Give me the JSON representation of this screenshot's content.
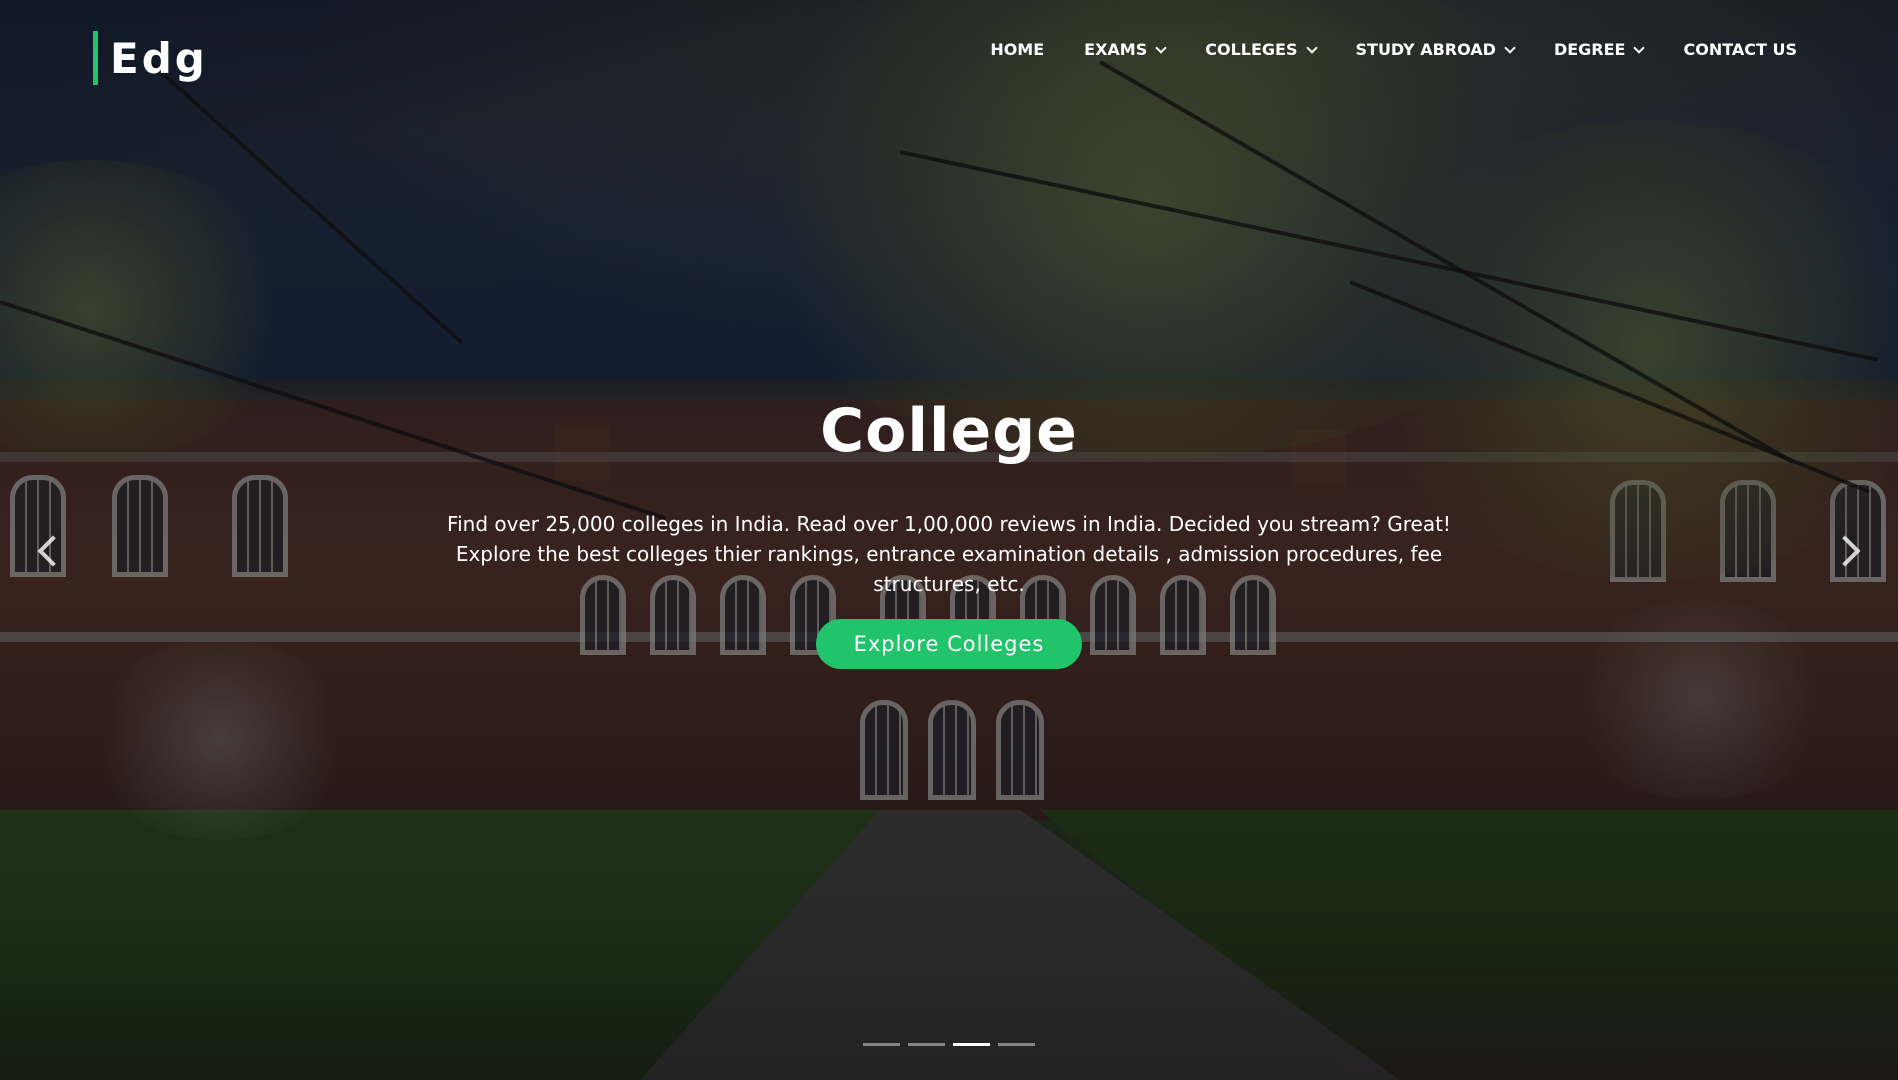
{
  "logo": {
    "text": "Edg",
    "accent_color": "#20c46a"
  },
  "nav": {
    "items": [
      {
        "label": "HOME",
        "dropdown": false
      },
      {
        "label": "EXAMS",
        "dropdown": true
      },
      {
        "label": "COLLEGES",
        "dropdown": true
      },
      {
        "label": "STUDY ABROAD",
        "dropdown": true
      },
      {
        "label": "DEGREE",
        "dropdown": true
      },
      {
        "label": "CONTACT US",
        "dropdown": false
      }
    ]
  },
  "hero": {
    "title": "College",
    "description": "Find over 25,000 colleges in India. Read over 1,00,000 reviews in India. Decided you stream? Great! Explore the best colleges thier rankings, entrance examination details , admission procedures, fee structures, etc.",
    "cta_label": "Explore Colleges",
    "cta_color": "#22c46b"
  },
  "carousel": {
    "prev_icon": "chevron-left-icon",
    "next_icon": "chevron-right-icon",
    "slide_count": 4,
    "active_index": 2
  }
}
